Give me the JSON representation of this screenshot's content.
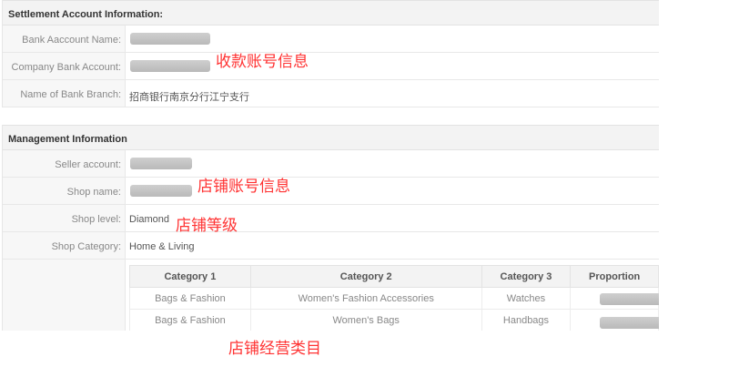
{
  "settlement": {
    "title": "Settlement Account Information:",
    "rows": [
      {
        "label": "Bank Aaccount Name:",
        "value": ""
      },
      {
        "label": "Company Bank Account:",
        "value": ""
      },
      {
        "label": "Name of Bank Branch:",
        "value": "招商银行南京分行江宁支行"
      }
    ]
  },
  "management": {
    "title": "Management Information",
    "rows": [
      {
        "label": "Seller account:",
        "value": ""
      },
      {
        "label": "Shop name:",
        "value": ""
      },
      {
        "label": "Shop level:",
        "value": "Diamond"
      },
      {
        "label": "Shop Category:",
        "value": "Home & Living"
      }
    ],
    "table": {
      "headers": [
        "Category 1",
        "Category 2",
        "Category 3",
        "Proportion"
      ],
      "rows": [
        [
          "Bags & Fashion",
          "Women's Fashion Accessories",
          "Watches",
          ""
        ],
        [
          "Bags & Fashion",
          "Women's Bags",
          "Handbags",
          ""
        ]
      ]
    }
  },
  "annotations": {
    "bank": "收款账号信息",
    "shop": "店铺账号信息",
    "level": "店铺等级",
    "category": "店铺经营类目"
  }
}
